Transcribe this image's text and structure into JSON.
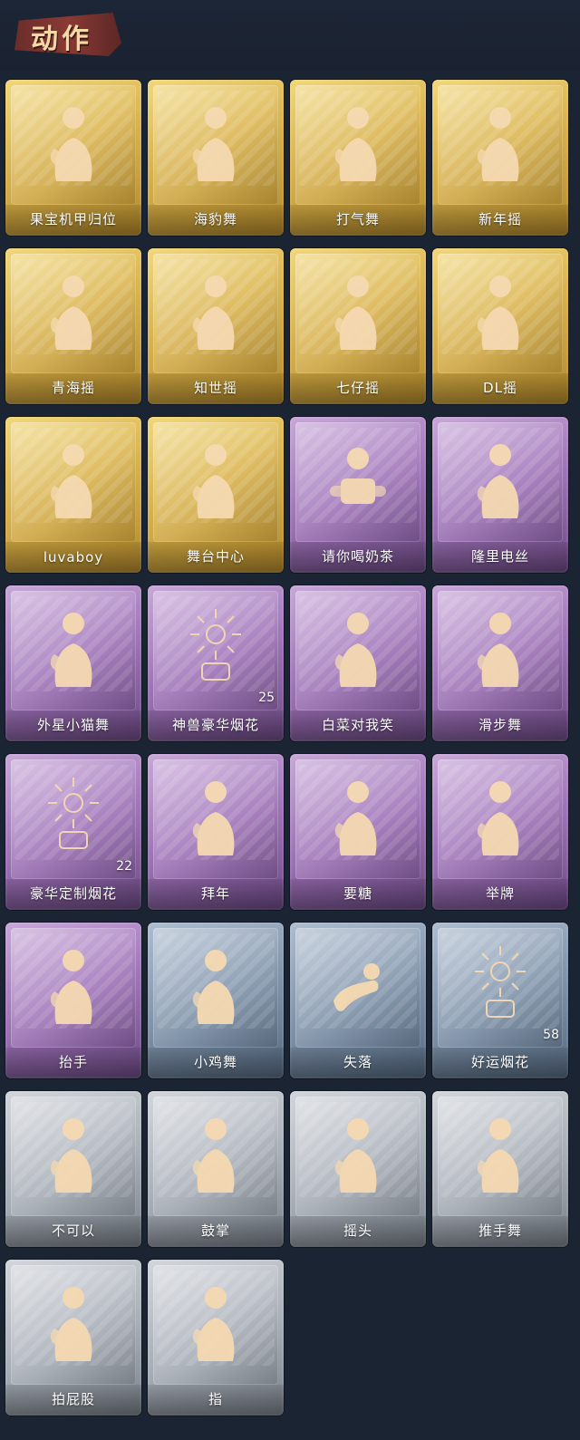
{
  "header": {
    "title": "动作"
  },
  "cards": [
    {
      "label": "果宝机甲归位",
      "tier": "gold",
      "icon": "dance-pose-icon"
    },
    {
      "label": "海豹舞",
      "tier": "gold",
      "icon": "dance-pose-icon"
    },
    {
      "label": "打气舞",
      "tier": "gold",
      "icon": "dance-pose-icon"
    },
    {
      "label": "新年摇",
      "tier": "gold",
      "icon": "dance-pose-icon"
    },
    {
      "label": "青海摇",
      "tier": "gold",
      "icon": "dance-pose-icon"
    },
    {
      "label": "知世摇",
      "tier": "gold",
      "icon": "dance-pose-icon"
    },
    {
      "label": "七仔摇",
      "tier": "gold",
      "icon": "dance-pose-icon"
    },
    {
      "label": "DL摇",
      "tier": "gold",
      "icon": "dance-pose-icon"
    },
    {
      "label": "luvaboy",
      "tier": "gold",
      "icon": "dance-pose-icon"
    },
    {
      "label": "舞台中心",
      "tier": "gold",
      "icon": "dance-pose-icon"
    },
    {
      "label": "请你喝奶茶",
      "tier": "purple",
      "icon": "milk-tea-icon"
    },
    {
      "label": "隆里电丝",
      "tier": "purple",
      "icon": "dance-pose-icon"
    },
    {
      "label": "外星小猫舞",
      "tier": "purple",
      "icon": "dance-pose-icon"
    },
    {
      "label": "神兽豪华烟花",
      "tier": "purple",
      "icon": "firework-icon",
      "count": "25"
    },
    {
      "label": "白菜对我笑",
      "tier": "purple",
      "icon": "dance-pose-icon"
    },
    {
      "label": "滑步舞",
      "tier": "purple",
      "icon": "dance-pose-icon"
    },
    {
      "label": "豪华定制烟花",
      "tier": "purple",
      "icon": "firework-box-icon",
      "count": "22"
    },
    {
      "label": "拜年",
      "tier": "purple",
      "icon": "greeting-pose-icon"
    },
    {
      "label": "要糖",
      "tier": "purple",
      "icon": "ask-pose-icon"
    },
    {
      "label": "举牌",
      "tier": "purple",
      "icon": "sign-pose-icon"
    },
    {
      "label": "抬手",
      "tier": "purple",
      "icon": "raise-hand-icon"
    },
    {
      "label": "小鸡舞",
      "tier": "blue",
      "icon": "chicken-dance-icon"
    },
    {
      "label": "失落",
      "tier": "blue",
      "icon": "crawl-pose-icon"
    },
    {
      "label": "好运烟花",
      "tier": "blue",
      "icon": "firework-can-icon",
      "count": "58"
    },
    {
      "label": "不可以",
      "tier": "gray",
      "icon": "finger-no-icon"
    },
    {
      "label": "鼓掌",
      "tier": "gray",
      "icon": "clap-icon"
    },
    {
      "label": "摇头",
      "tier": "gray",
      "icon": "shake-head-icon"
    },
    {
      "label": "推手舞",
      "tier": "gray",
      "icon": "push-hand-icon"
    },
    {
      "label": "拍屁股",
      "tier": "gray",
      "icon": "pat-pose-icon"
    },
    {
      "label": "指",
      "tier": "gray",
      "icon": "point-icon"
    }
  ]
}
